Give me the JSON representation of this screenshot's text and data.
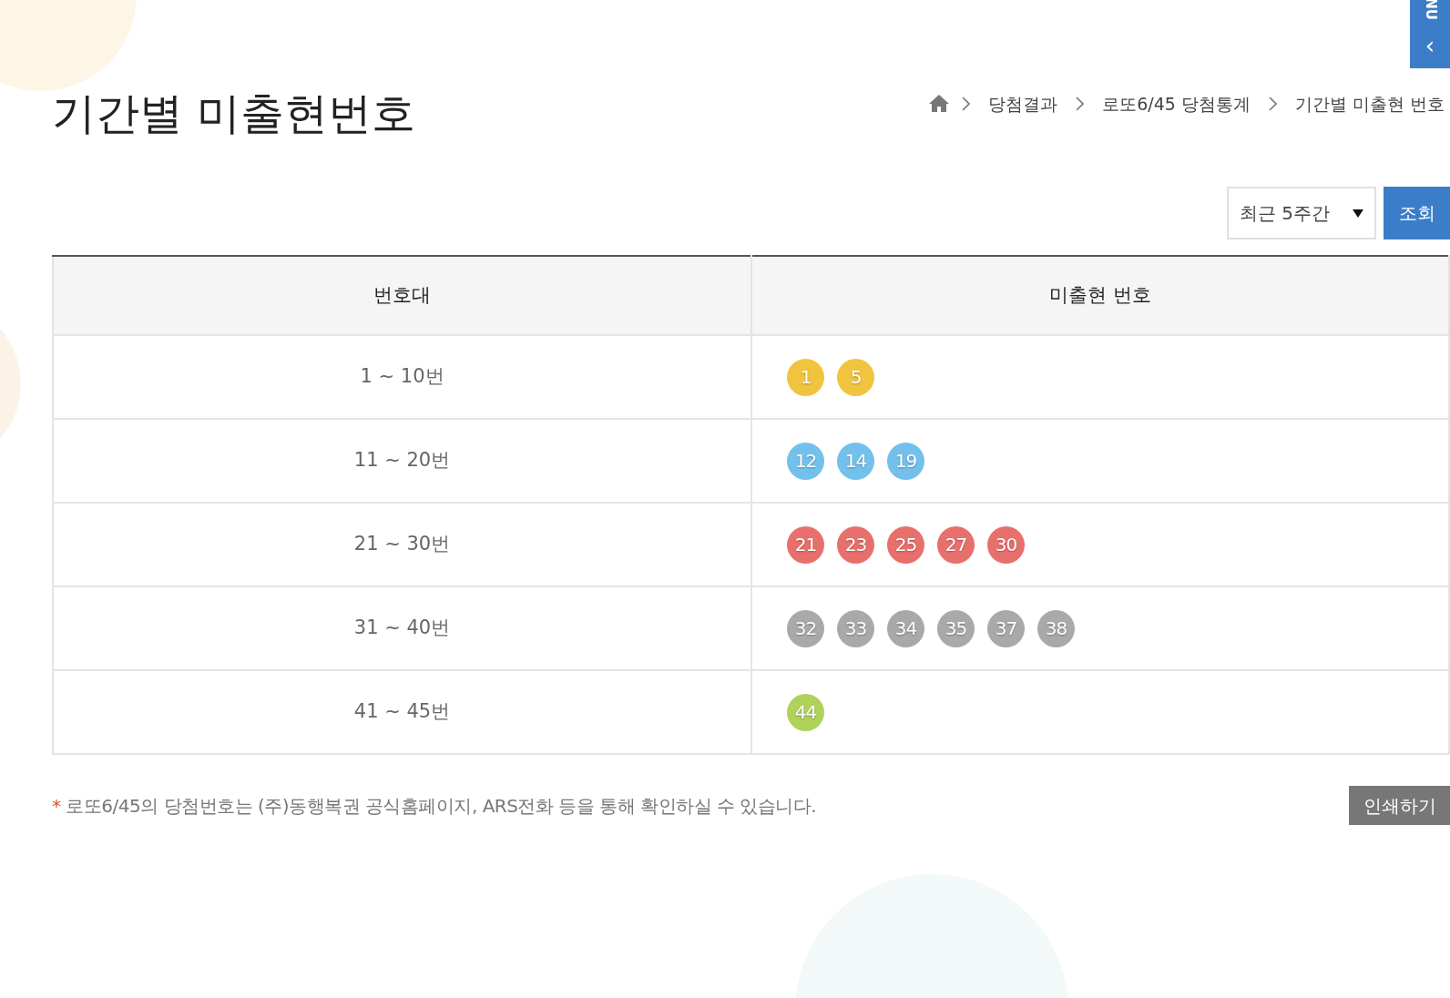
{
  "side_tab": {
    "label": "NU",
    "arrow": "‹"
  },
  "title": "기간별 미출현번호",
  "breadcrumb": [
    "당첨결과",
    "로또6/45 당첨통계",
    "기간별 미출현 번호"
  ],
  "period_select": {
    "value": "최근 5주간"
  },
  "search_button": "조회",
  "table": {
    "columns": [
      "번호대",
      "미출현 번호"
    ],
    "rows": [
      {
        "range": "1 ~ 10번",
        "balls": [
          {
            "number": "1",
            "color": "#f0c43f"
          },
          {
            "number": "5",
            "color": "#f0c43f"
          }
        ]
      },
      {
        "range": "11 ~ 20번",
        "balls": [
          {
            "number": "12",
            "color": "#74c0ec"
          },
          {
            "number": "14",
            "color": "#74c0ec"
          },
          {
            "number": "19",
            "color": "#74c0ec"
          }
        ]
      },
      {
        "range": "21 ~ 30번",
        "balls": [
          {
            "number": "21",
            "color": "#e8706c"
          },
          {
            "number": "23",
            "color": "#e8706c"
          },
          {
            "number": "25",
            "color": "#e8706c"
          },
          {
            "number": "27",
            "color": "#e8706c"
          },
          {
            "number": "30",
            "color": "#e8706c"
          }
        ]
      },
      {
        "range": "31 ~ 40번",
        "balls": [
          {
            "number": "32",
            "color": "#a9a9a9"
          },
          {
            "number": "33",
            "color": "#a9a9a9"
          },
          {
            "number": "34",
            "color": "#a9a9a9"
          },
          {
            "number": "35",
            "color": "#a9a9a9"
          },
          {
            "number": "37",
            "color": "#a9a9a9"
          },
          {
            "number": "38",
            "color": "#a9a9a9"
          }
        ]
      },
      {
        "range": "41 ~ 45번",
        "balls": [
          {
            "number": "44",
            "color": "#b1d25a"
          }
        ]
      }
    ]
  },
  "note": {
    "mark": "*",
    "text": "로또6/45의 당첨번호는 (주)동행복권 공식홈페이지, ARS전화 등을 통해 확인하실 수 있습니다."
  },
  "print_button": "인쇄하기"
}
